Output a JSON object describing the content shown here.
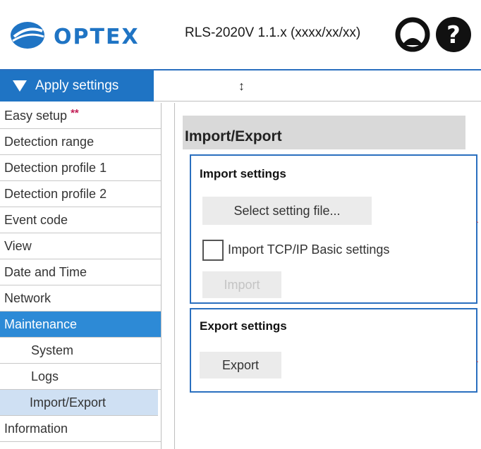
{
  "header": {
    "brand": "OPTEX",
    "product": "RLS-2020V 1.1.x (xxxx/xx/xx)",
    "user_icon": "user-circle-icon",
    "help_icon": "help-icon",
    "accent": "#1f74c4"
  },
  "apply_bar": {
    "label": "Apply settings",
    "resize_glyph": "↕"
  },
  "sidebar": {
    "items": [
      {
        "label": "Easy setup",
        "badge": "**"
      },
      {
        "label": "Detection range"
      },
      {
        "label": "Detection profile 1"
      },
      {
        "label": "Detection profile 2"
      },
      {
        "label": "Event code"
      },
      {
        "label": "View"
      },
      {
        "label": "Date and Time"
      },
      {
        "label": "Network"
      },
      {
        "label": "Maintenance",
        "state": "active"
      },
      {
        "label": "System",
        "sub": true
      },
      {
        "label": "Logs",
        "sub": true
      },
      {
        "label": "Import/Export",
        "sub": true,
        "state": "selected"
      },
      {
        "label": "Information"
      }
    ]
  },
  "main": {
    "title": "Import/Export",
    "import": {
      "heading": "Import settings",
      "select_button": "Select setting file...",
      "checkbox_label": "Import TCP/IP Basic settings",
      "checkbox_checked": false,
      "import_button": "Import",
      "import_disabled": true
    },
    "export": {
      "heading": "Export settings",
      "export_button": "Export"
    }
  }
}
